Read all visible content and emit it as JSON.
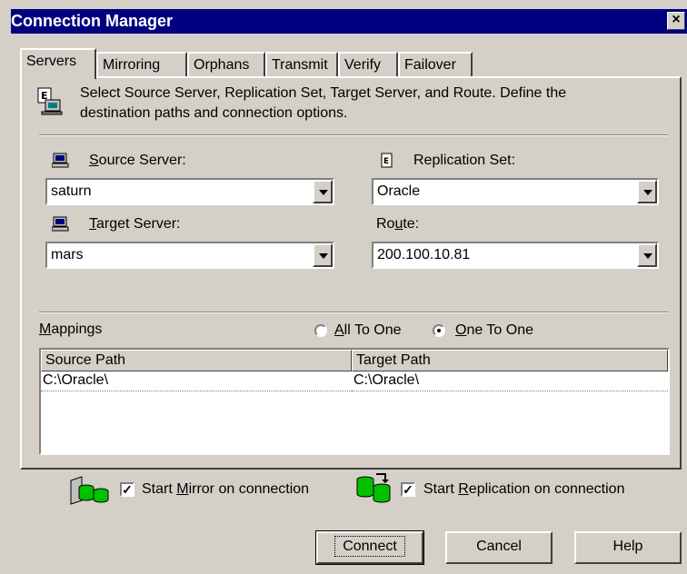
{
  "window": {
    "title": "Connection Manager",
    "close_label": "×"
  },
  "tabs": [
    {
      "label": "Servers",
      "active": true
    },
    {
      "label": "Mirroring",
      "active": false
    },
    {
      "label": "Orphans",
      "active": false
    },
    {
      "label": "Transmit",
      "active": false
    },
    {
      "label": "Verify",
      "active": false
    },
    {
      "label": "Failover",
      "active": false
    }
  ],
  "instructions": {
    "line1": "Select Source Server, Replication Set, Target Server, and Route.  Define the",
    "line2": "destination paths and connection options."
  },
  "source_server": {
    "label_pre": "",
    "label_accel": "S",
    "label_post": "ource Server:",
    "value": "saturn"
  },
  "replication_set": {
    "label": "Replication Set:",
    "value": "Oracle"
  },
  "target_server": {
    "label_pre": "",
    "label_accel": "T",
    "label_post": "arget Server:",
    "value": "mars"
  },
  "route": {
    "label_pre": "Ro",
    "label_accel": "u",
    "label_post": "te:",
    "value": "200.100.10.81"
  },
  "mappings": {
    "label_accel": "M",
    "label_post": "appings",
    "all_to_one": {
      "accel": "A",
      "rest": "ll To One",
      "selected": false
    },
    "one_to_one": {
      "accel": "O",
      "rest": "ne To One",
      "selected": true
    },
    "columns": [
      "Source Path",
      "Target Path"
    ],
    "rows": [
      {
        "source": "C:\\Oracle\\",
        "target": "C:\\Oracle\\"
      }
    ]
  },
  "options": {
    "start_mirror": {
      "pre": "Start ",
      "accel": "M",
      "post": "irror on connection",
      "checked": true
    },
    "start_replication": {
      "pre": "Start ",
      "accel": "R",
      "post": "eplication on connection",
      "checked": true
    }
  },
  "buttons": {
    "connect": "Connect",
    "cancel": "Cancel",
    "help": "Help"
  },
  "colors": {
    "titlebar": "#000080",
    "face": "#d4d0c8",
    "icon_green": "#00c000"
  }
}
